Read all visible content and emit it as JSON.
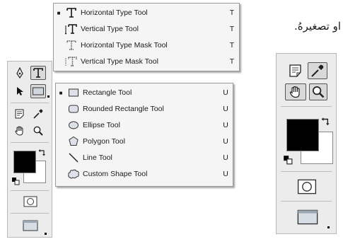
{
  "type_menu": {
    "items": [
      {
        "label": "Horizontal Type Tool",
        "shortcut": "T",
        "selected": true,
        "icon": "horizontal-type-icon"
      },
      {
        "label": "Vertical Type Tool",
        "shortcut": "T",
        "selected": false,
        "icon": "vertical-type-icon"
      },
      {
        "label": "Horizontal Type Mask Tool",
        "shortcut": "T",
        "selected": false,
        "icon": "horizontal-type-mask-icon"
      },
      {
        "label": "Vertical Type Mask Tool",
        "shortcut": "T",
        "selected": false,
        "icon": "vertical-type-mask-icon"
      }
    ]
  },
  "shape_menu": {
    "items": [
      {
        "label": "Rectangle Tool",
        "shortcut": "U",
        "selected": true,
        "icon": "rectangle-icon"
      },
      {
        "label": "Rounded Rectangle Tool",
        "shortcut": "U",
        "selected": false,
        "icon": "rounded-rectangle-icon"
      },
      {
        "label": "Ellipse Tool",
        "shortcut": "U",
        "selected": false,
        "icon": "ellipse-icon"
      },
      {
        "label": "Polygon Tool",
        "shortcut": "U",
        "selected": false,
        "icon": "polygon-icon"
      },
      {
        "label": "Line Tool",
        "shortcut": "U",
        "selected": false,
        "icon": "line-icon"
      },
      {
        "label": "Custom Shape Tool",
        "shortcut": "U",
        "selected": false,
        "icon": "custom-shape-icon"
      }
    ]
  },
  "toolbox_left": {
    "tools": [
      "pen-tool-icon",
      "type-tool-icon",
      "path-selection-icon",
      "rectangle-shape-icon",
      "notes-icon",
      "eyedropper-icon",
      "hand-icon",
      "zoom-icon"
    ],
    "foreground_color": "#000000",
    "background_color": "#ffffff"
  },
  "toolbox_right": {
    "tools": [
      "notes-icon",
      "eyedropper-icon",
      "hand-icon",
      "zoom-icon"
    ],
    "foreground_color": "#000000",
    "background_color": "#ffffff"
  },
  "page_text": {
    "arabic": "او تصغيرهُ."
  },
  "bullet": "■"
}
